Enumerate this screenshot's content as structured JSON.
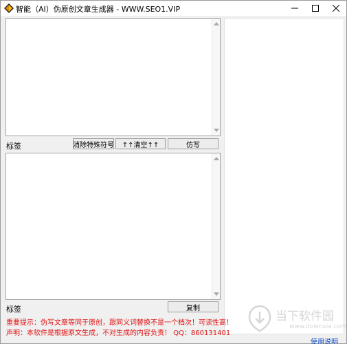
{
  "window": {
    "title": "智能（AI）伪原创文章生成器 - WWW.SEO1.VIP"
  },
  "top_section": {
    "label": "标签",
    "buttons": {
      "clear_special": "消除特殊符号",
      "clear_up": "↑↑清空↑↑",
      "rewrite": "仿写"
    }
  },
  "bottom_section": {
    "label": "标签",
    "copy_button": "复制"
  },
  "notices": {
    "important": "重要提示：伪写文章等同于原创，跟同义词替换不是一个档次！可读性高！",
    "disclaimer": "声明：本软件是根据原文生成，不对生成的内容负责！ QQ：860131401"
  },
  "watermark": {
    "text": "当下软件园",
    "url": "www.downxia.com"
  },
  "help_link": "使用说明",
  "icons": {
    "app": "diamond-app-icon",
    "minimize": "minimize-icon",
    "maximize": "maximize-icon",
    "close": "close-icon"
  },
  "colors": {
    "notice": "#e01010",
    "link": "#0a4cc8"
  }
}
